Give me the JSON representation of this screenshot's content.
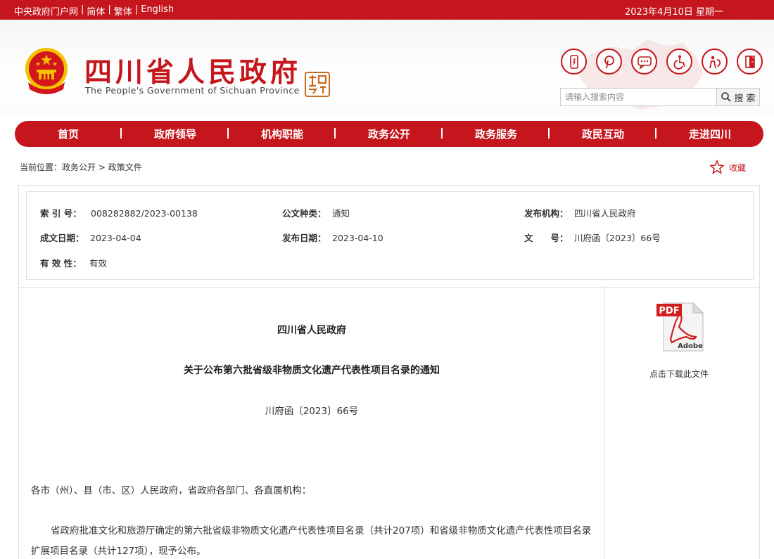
{
  "topbar": {
    "links": [
      "中央政府门户网",
      "简体",
      "繁体",
      "English"
    ],
    "separator": "|",
    "date": "2023年4月10日 星期一"
  },
  "header": {
    "title": "四川省人民政府",
    "subtitle": "The People's Government of Sichuan Province",
    "tools": [
      {
        "icon": "mobile-icon"
      },
      {
        "icon": "weibo-icon"
      },
      {
        "icon": "chat-icon"
      },
      {
        "icon": "accessibility-icon"
      },
      {
        "icon": "elderly-care-icon"
      },
      {
        "icon": "exit-door-icon"
      }
    ],
    "search": {
      "placeholder": "请输入搜索内容",
      "button_label": "搜 索"
    }
  },
  "nav": {
    "items": [
      "首页",
      "政府领导",
      "机构职能",
      "政务公开",
      "政务服务",
      "政民互动",
      "走进四川"
    ]
  },
  "breadcrumb": {
    "prefix": "当前位置：",
    "items": [
      "政务公开",
      "政策文件"
    ],
    "separator": ">"
  },
  "favorite": {
    "label": "收藏"
  },
  "meta": {
    "index_label": "索 引 号：",
    "index_value": "008282882/2023-00138",
    "doctype_label": "公文种类：",
    "doctype_value": "通知",
    "publisher_label": "发布机构：",
    "publisher_value": "四川省人民政府",
    "created_label": "成文日期：",
    "created_value": "2023-04-04",
    "published_label": "发布日期：",
    "published_value": "2023-04-10",
    "docnum_label": "文　　号：",
    "docnum_value": "川府函〔2023〕66号",
    "validity_label": "有 效 性：",
    "validity_value": "有效"
  },
  "document": {
    "issuer": "四川省人民政府",
    "title": "关于公布第六批省级非物质文化遗产代表性项目名录的通知",
    "number": "川府函〔2023〕66号",
    "greeting": "各市（州）、县（市、区）人民政府，省政府各部门、各直属机构：",
    "body": "省政府批准文化和旅游厅确定的第六批省级非物质文化遗产代表性项目名录（共计207项）和省级非物质文化遗产代表性项目名录扩展项目名录（共计127项），现予公布。"
  },
  "download": {
    "badge": "PDF",
    "brand": "Adobe",
    "label": "点击下载此文件"
  },
  "colors": {
    "brand_red": "#c4161c",
    "gold": "#f2c100"
  }
}
